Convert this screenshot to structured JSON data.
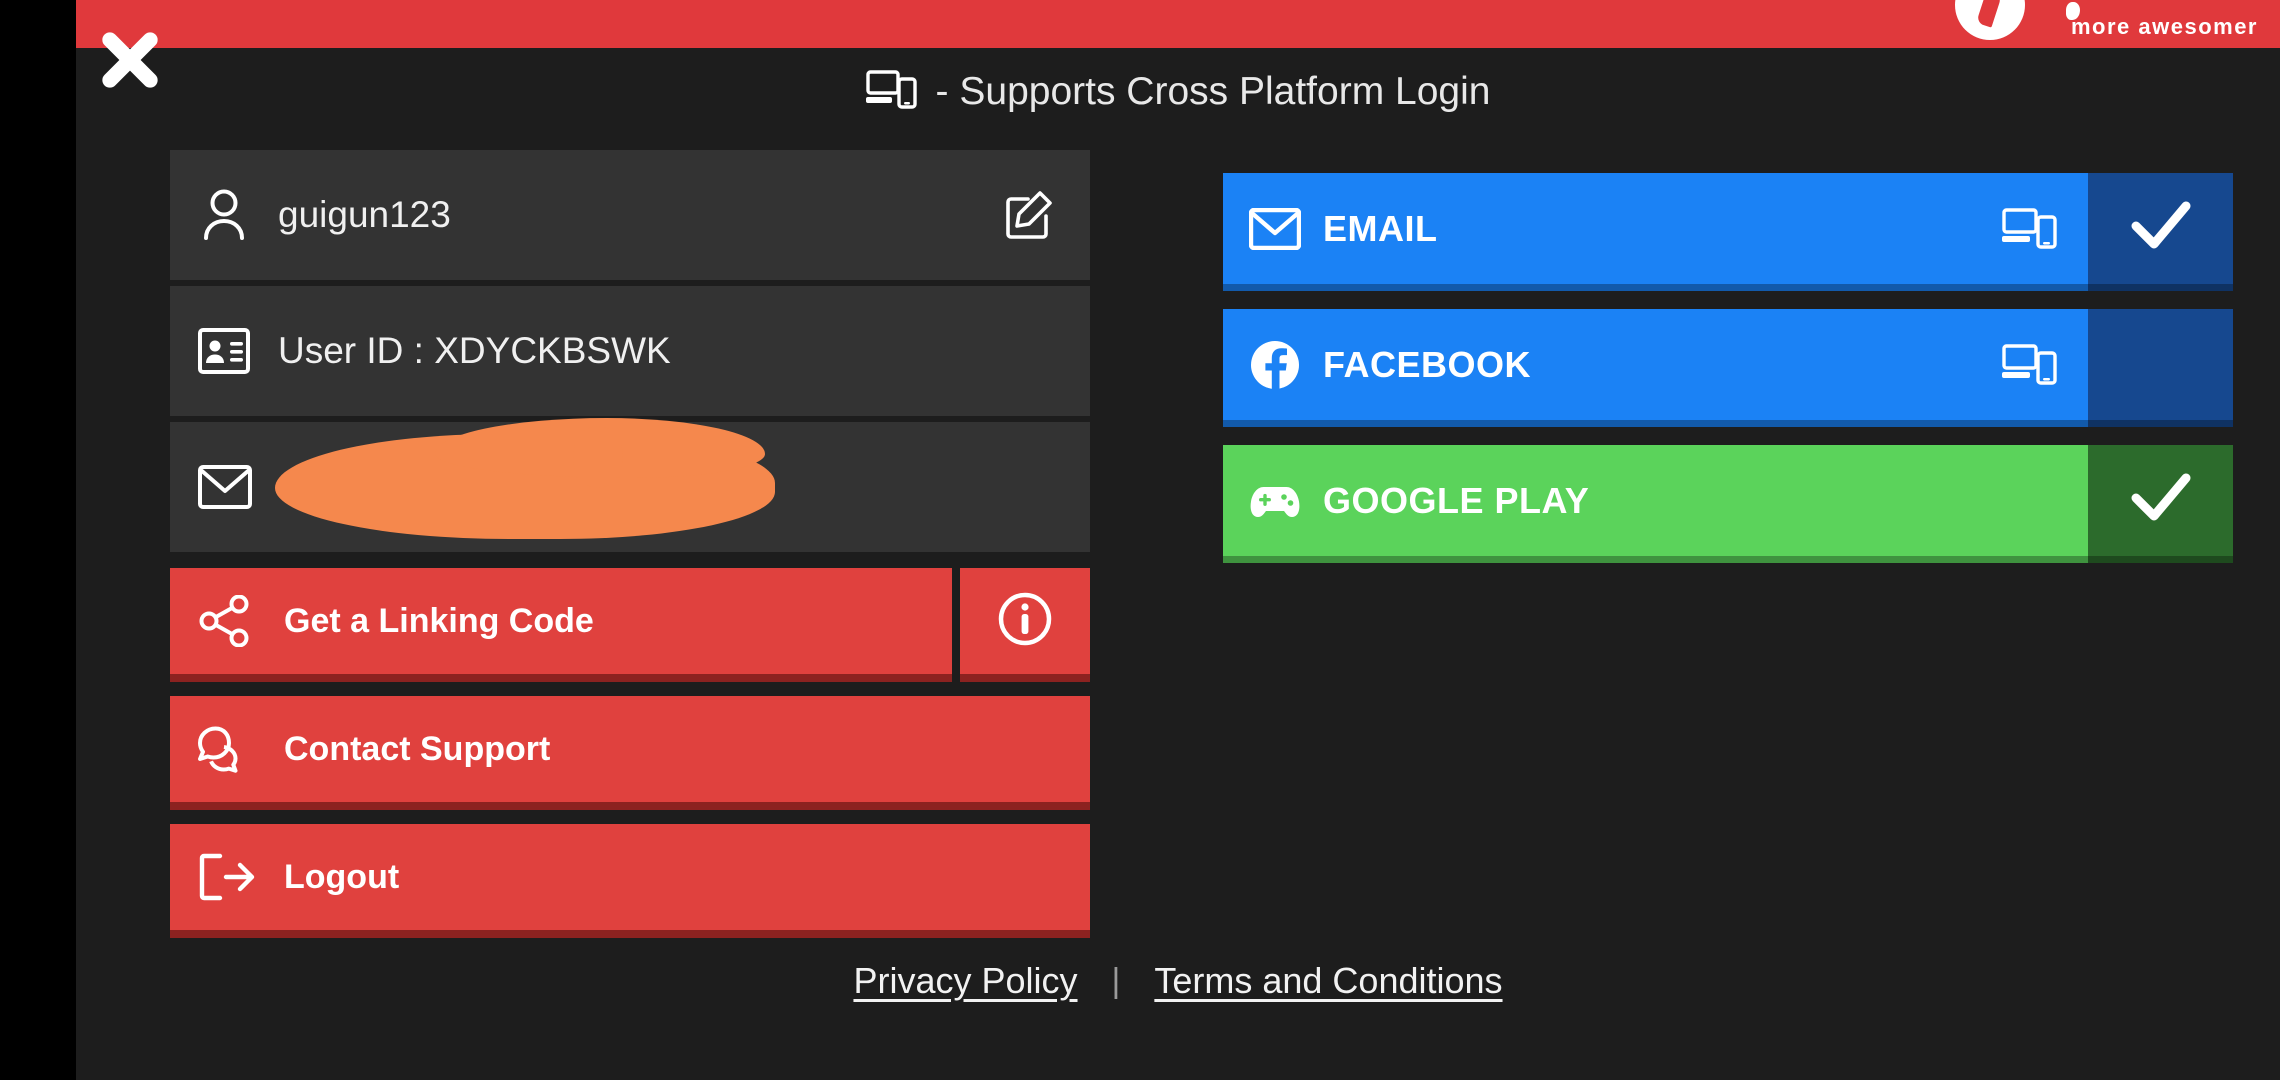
{
  "ad_banner": {
    "text": "more awesomer",
    "logo_icon": "circle-logo-icon",
    "background_color": "#E0393C"
  },
  "close_button": {
    "icon": "close-x-icon",
    "label": "Close"
  },
  "header": {
    "icon": "cross-platform-device-icon",
    "title": "- Supports Cross Platform Login"
  },
  "account": {
    "username_row": {
      "icon": "person-icon",
      "value": "guigun123",
      "edit_icon": "edit-pencil-icon"
    },
    "userid_row": {
      "icon": "id-card-icon",
      "value": "User ID : XDYCKBSWK"
    },
    "email_row": {
      "icon": "envelope-icon",
      "value": "",
      "redacted": true,
      "redaction_color": "#F5884D"
    }
  },
  "actions": [
    {
      "label": "Get a Linking Code",
      "icon": "share-nodes-icon",
      "color": "#E0413E"
    },
    {
      "label": "Contact Support",
      "icon": "chat-bubbles-icon",
      "color": "#E0413E"
    },
    {
      "label": "Logout",
      "icon": "logout-arrow-icon",
      "color": "#E0413E"
    }
  ],
  "info_button": {
    "icon": "info-circle-icon"
  },
  "platforms": [
    {
      "label": "EMAIL",
      "icon": "envelope-icon",
      "cross_platform": true,
      "connected": true,
      "check_icon": "check-icon",
      "color": "#1B82F5",
      "side_color": "#16488F"
    },
    {
      "label": "FACEBOOK",
      "icon": "facebook-icon",
      "cross_platform": true,
      "connected": false,
      "check_icon": "",
      "color": "#1B82F5",
      "side_color": "#16488F"
    },
    {
      "label": "GOOGLE PLAY",
      "icon": "gamepad-icon",
      "cross_platform": false,
      "connected": true,
      "check_icon": "check-icon",
      "color": "#5BD35B",
      "side_color": "#2C6B2C"
    }
  ],
  "footer": {
    "privacy_label": "Privacy Policy",
    "separator": "|",
    "terms_label": "Terms and Conditions"
  }
}
